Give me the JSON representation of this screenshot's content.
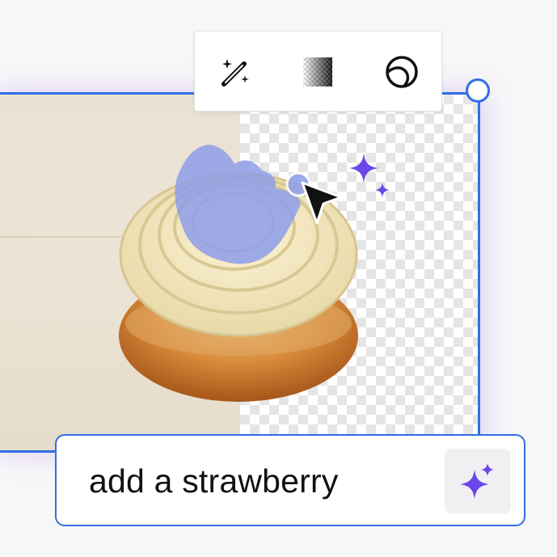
{
  "toolbar": {
    "tools": [
      {
        "name": "magic-wand-icon"
      },
      {
        "name": "transparency-icon"
      },
      {
        "name": "shape-icon"
      }
    ]
  },
  "prompt": {
    "value": "add a strawberry"
  },
  "colors": {
    "accent": "#2f6fe4",
    "selection_blue": "#8e9ee9",
    "sparkle_purple": "#6b46e8"
  }
}
